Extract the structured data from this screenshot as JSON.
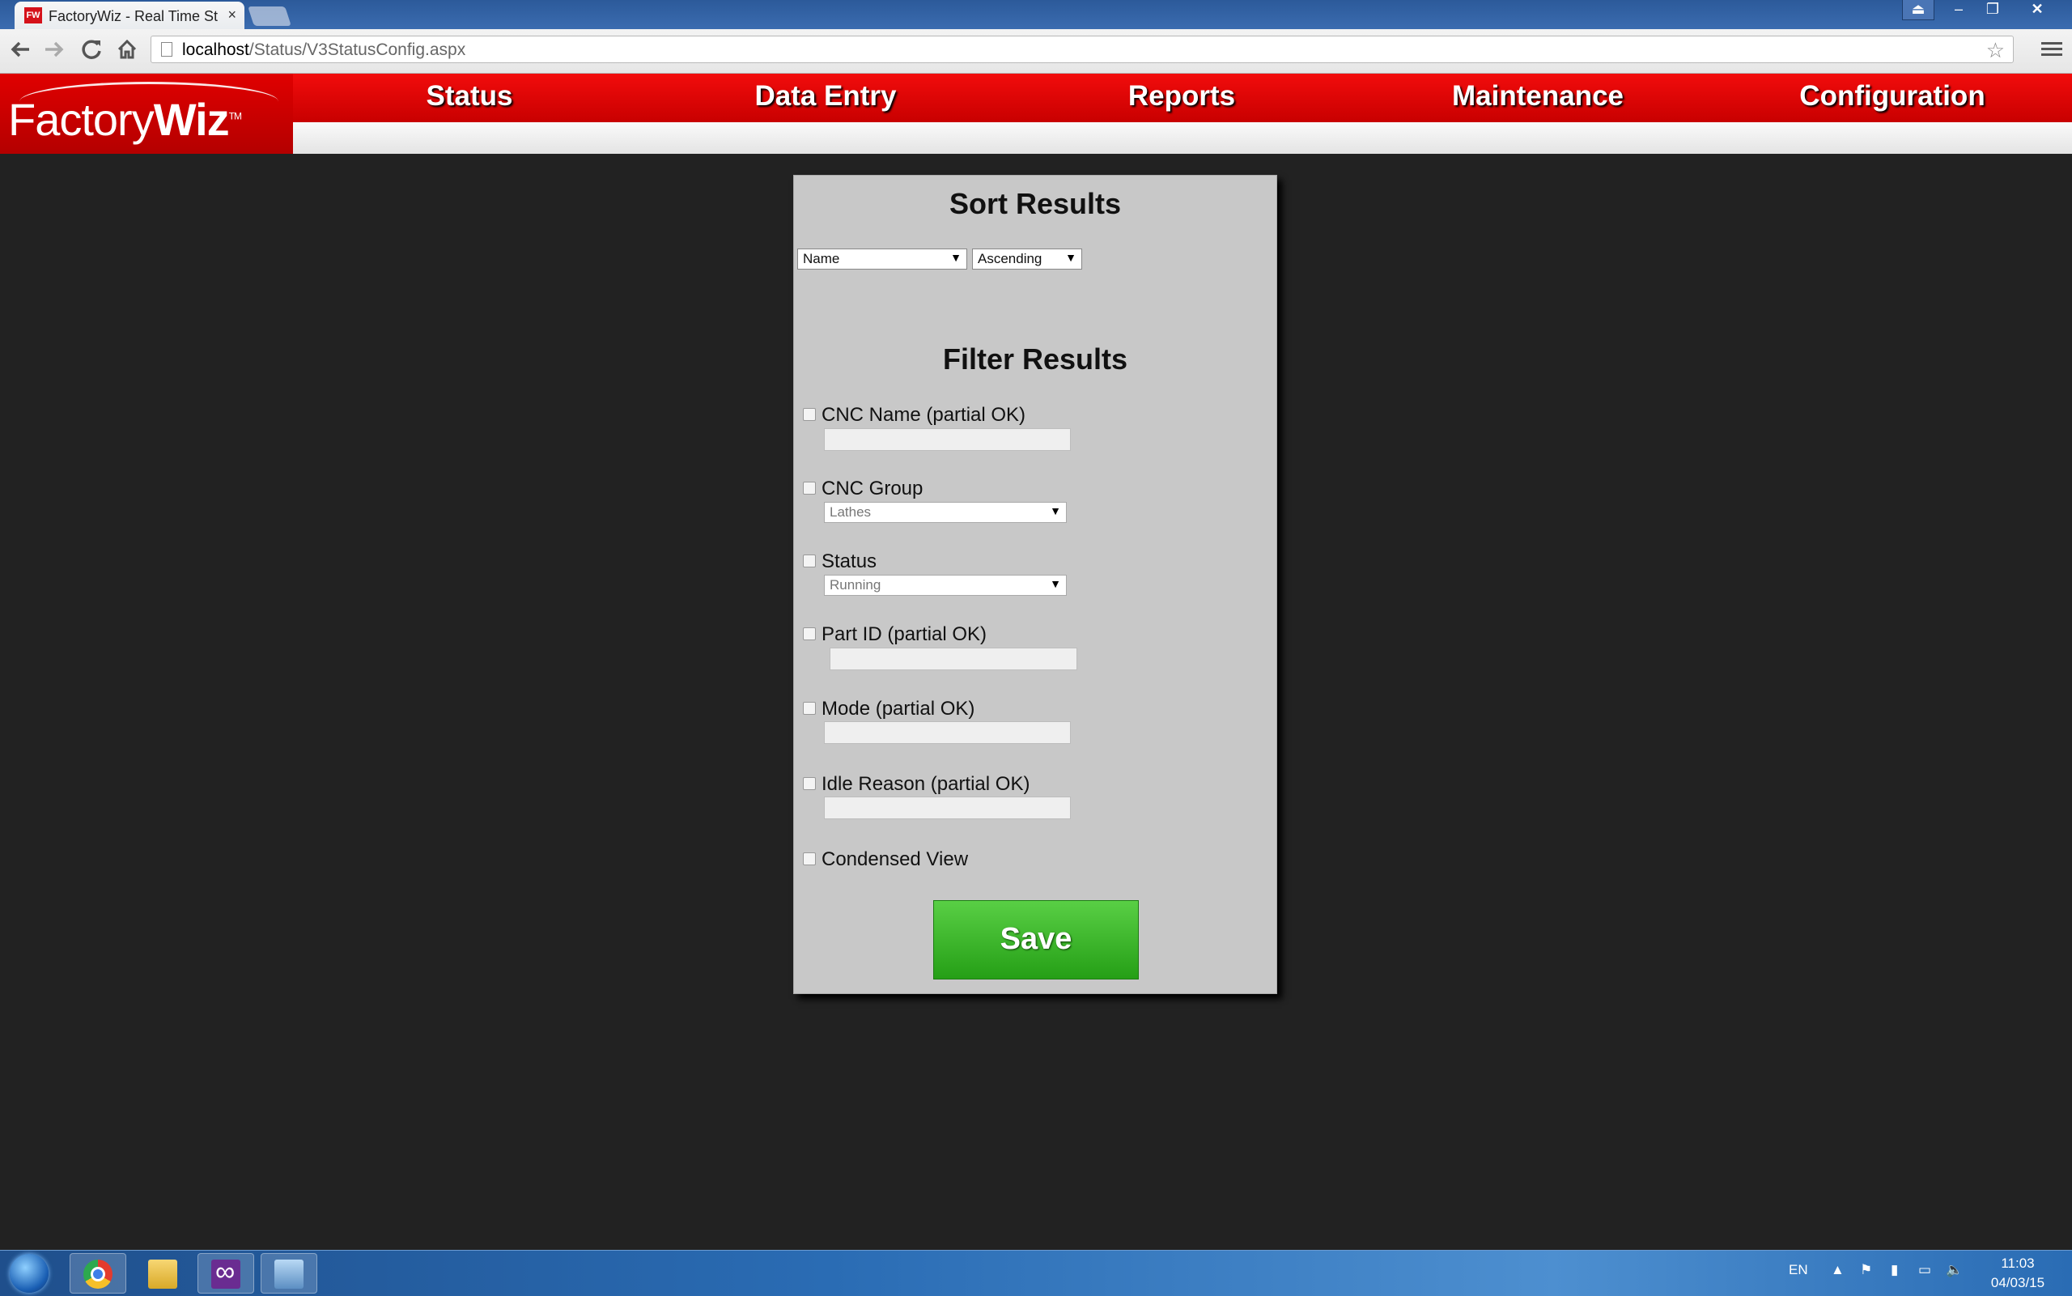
{
  "browser": {
    "tab_title": "FactoryWiz - Real Time St",
    "favicon_text": "FW",
    "tab_close": "×",
    "url_host": "localhost",
    "url_path": "/Status/V3StatusConfig.aspx",
    "window_buttons": {
      "user": "⏏",
      "minimize": "–",
      "maximize": "❐",
      "close": "✕"
    },
    "icons": {
      "back": "back-arrow-icon",
      "forward": "forward-arrow-icon",
      "reload": "reload-icon",
      "home": "home-icon",
      "star": "bookmark-star-icon",
      "menu": "hamburger-menu-icon"
    }
  },
  "header": {
    "logo_part1": "Factory",
    "logo_part2": "Wiz",
    "logo_tm": "TM",
    "nav": [
      "Status",
      "Data Entry",
      "Reports",
      "Maintenance",
      "Configuration"
    ],
    "colors": {
      "brand_red": "#d40000",
      "background": "#222222"
    }
  },
  "panel": {
    "sort_title": "Sort Results",
    "sort_field": {
      "value": "Name"
    },
    "sort_order": {
      "value": "Ascending"
    },
    "filter_title": "Filter Results",
    "filters": {
      "cnc_name": {
        "label": "CNC Name (partial OK)",
        "checked": false,
        "value": ""
      },
      "cnc_group": {
        "label": "CNC Group",
        "checked": false,
        "value": "Lathes"
      },
      "status": {
        "label": "Status",
        "checked": false,
        "value": "Running"
      },
      "part_id": {
        "label": "Part ID (partial OK)",
        "checked": false,
        "value": ""
      },
      "mode": {
        "label": "Mode (partial OK)",
        "checked": false,
        "value": ""
      },
      "idle_reason": {
        "label": "Idle Reason (partial OK)",
        "checked": false,
        "value": ""
      },
      "condensed_view": {
        "label": "Condensed View",
        "checked": false
      }
    },
    "save_label": "Save",
    "save_color": "#3cb52a"
  },
  "taskbar": {
    "apps": [
      "start-orb-icon",
      "chrome-icon",
      "file-explorer-icon",
      "visual-studio-icon",
      "remote-desktop-icon"
    ],
    "language": "EN",
    "time": "11:03",
    "date": "04/03/15"
  }
}
